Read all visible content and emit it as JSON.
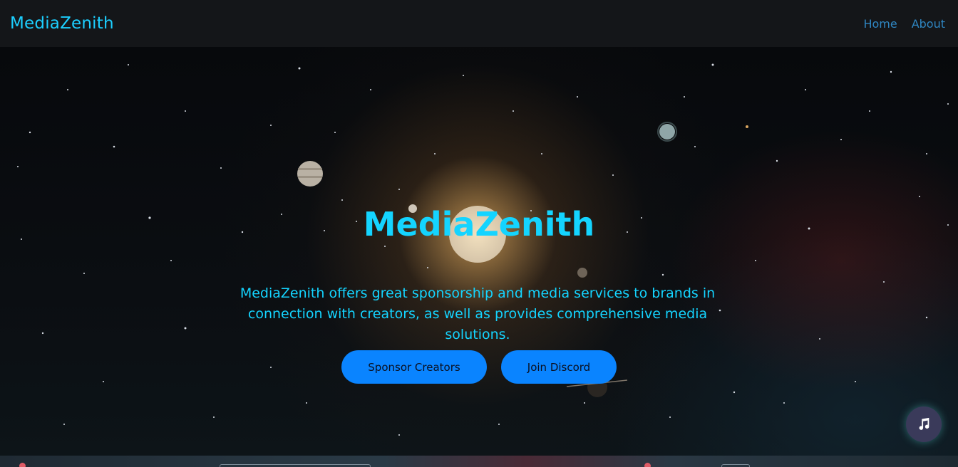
{
  "navbar": {
    "brand": "MediaZenith",
    "links": [
      "Home",
      "About"
    ]
  },
  "hero": {
    "title": "MediaZenith",
    "description": "MediaZenith offers great sponsorship and media services to brands in connection with creators, as well as provides comprehensive media solutions.",
    "buttons": [
      "Sponsor Creators",
      "Join Discord"
    ]
  },
  "music_button": {
    "icon": "music-note-icon"
  },
  "colors": {
    "accent": "#14d4ff",
    "button": "#0a84ff",
    "nav_link": "#2f86c2",
    "navbar_bg": "#141619"
  }
}
